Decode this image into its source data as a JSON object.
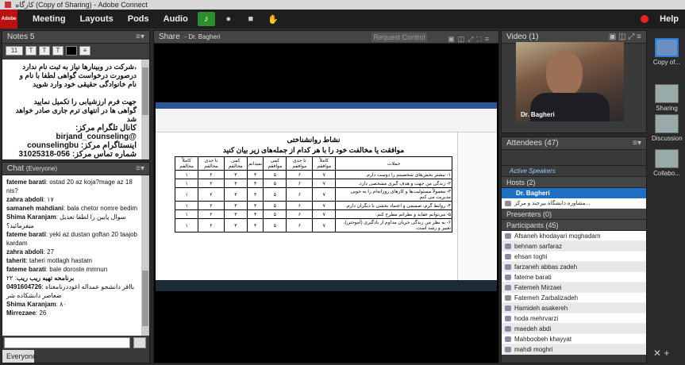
{
  "window_title": "کارگاه (Copy of Sharing) - Adobe Connect",
  "menubar": {
    "logo": "Adobe",
    "items": [
      "Meeting",
      "Layouts",
      "Pods",
      "Audio"
    ],
    "help": "Help"
  },
  "notes": {
    "title": "Notes 5",
    "font_size": "11",
    "lines": [
      "،شرکت در وبینارها نیاز به ثبت نام ندارد",
      "درصورت درخواست گواهی لطفا با نام و",
      "نام خانوادگی حقیقی خود وارد شوید",
      "",
      "جهت فرم ارزشیابی را تکمیل نمایید",
      "گواهی ها در انتهای ترم جاری صادر خواهد شد"
    ],
    "telegram": "کانال تلگرام مرکز: @birjand_counseling",
    "instagram": "اینستاگرام مرکز: counselingbu",
    "phone": "شماره تماس مرکز: 056-31025318"
  },
  "chat": {
    "title": "Chat",
    "audience": "(Everyone)",
    "messages": [
      {
        "name": "fateme barati",
        "text": "ostad 20 az koja?mage az 18 nis?"
      },
      {
        "name": "zahra abdoli",
        "text": "۱۷"
      },
      {
        "name": "samaneh mahdiani",
        "text": "bala chetor nomre bedim"
      },
      {
        "name": "Shima Karanjam",
        "text": "سوال پایین را لطفا تعدیل میفرمائید؟"
      },
      {
        "name": "fateme barati",
        "text": "yeki az dustan goftan 20 taajob kardam"
      },
      {
        "name": "zahra abdoli",
        "text": "27"
      },
      {
        "name": "taherit",
        "text": "taheri motlagh hastam"
      },
      {
        "name": "fateme barati",
        "text": "bale doroste mmnun"
      },
      {
        "name": "برنامحه تهیه ریب ریب",
        "text": "۲۲"
      },
      {
        "name": "0491604726",
        "text": "بااقر دانشجو عمداله اغوددرنامغتاه ضعاصر دانشکاده شر"
      },
      {
        "name": "Shima Karanjam",
        "text": "۸۰"
      },
      {
        "name": "Mirrezaee",
        "text": "26"
      }
    ],
    "tab": "Everyone"
  },
  "share": {
    "title": "Share",
    "presenter": "Dr. Bagheri",
    "request_control": "Request Control",
    "doc_title": "نشاط روانشناختی",
    "doc_subtitle": "موافقت یا مخالفت خود را با هر کدام از جمله‌های زیر بیان کنید",
    "table_headers": [
      "جملات",
      "کاملاً موافقم",
      "تا حدی موافقم",
      "کمی موافقم",
      "نمیدانم",
      "کمی مخالفم",
      "تا حدی مخالفم",
      "کاملاً مخالفم"
    ],
    "table_rows": [
      [
        "۱- بیشتر بخش‌های شخصیتم را دوست دارم.",
        "۷",
        "۶",
        "۵",
        "۴",
        "۳",
        "۲",
        "۱"
      ],
      [
        "۲- زندگی من جهت و هدف گیری مشخصی دارد.",
        "۷",
        "۶",
        "۵",
        "۴",
        "۳",
        "۲",
        "۱"
      ],
      [
        "۳- معمولاً مسئولیت‌ها و کارهای روزانه‌ام را به خوبی مدیریت می کنم.",
        "۷",
        "۶",
        "۵",
        "۴",
        "۳",
        "۲",
        "۱"
      ],
      [
        "۴- روابط گرم، صمیمی و اعتماد بخشی با دیگران دارم.",
        "۷",
        "۶",
        "۵",
        "۴",
        "۳",
        "۲",
        "۱"
      ],
      [
        "۵- می‌توانم عقاید و نظراتم مطرح کنم.",
        "۷",
        "۶",
        "۵",
        "۴",
        "۳",
        "۲",
        "۱"
      ],
      [
        "۶- به نظر من زندگی جریان مداوم از یادگیری (آموختن)، تغییر و رشد است.",
        "۷",
        "۶",
        "۵",
        "۴",
        "۳",
        "۲",
        "۱"
      ]
    ]
  },
  "video": {
    "title": "Video",
    "count": "(1)",
    "label": "Dr. Bagheri"
  },
  "attendees": {
    "title": "Attendees",
    "count": "(47)",
    "active_speakers": "Active Speakers",
    "hosts_label": "Hosts (2)",
    "hosts": [
      "Dr. Bagheri",
      "مشاوره دانشگاه بیرجند و مرکز..."
    ],
    "presenters_label": "Presenters (0)",
    "participants_label": "Participants (45)",
    "participants": [
      "Afsaneh khodayari moghadam",
      "behnam sarfaraz",
      "ehsan toghi",
      "farzaneh abbas zadeh",
      "fateme barati",
      "Fatemeh Mirzaei",
      "Fatemeh Zarbalizadeh",
      "Hamideh asakereh",
      "hoda mehrvarzi",
      "maedeh abdi",
      "Mahboobeh khayyat",
      "mahdi moghri"
    ]
  },
  "layouts": [
    {
      "label": "Copy of..."
    },
    {
      "label": "Sharing"
    },
    {
      "label": "Discussion"
    },
    {
      "label": "Collabo..."
    }
  ]
}
